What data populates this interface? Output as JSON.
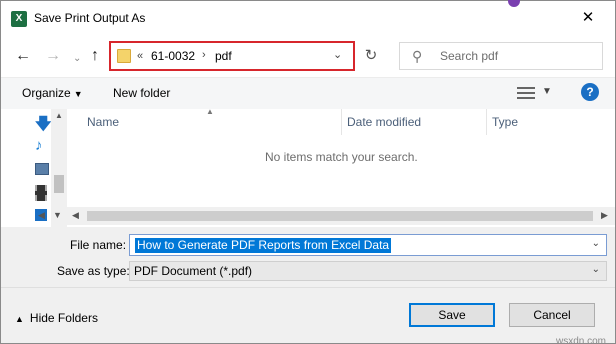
{
  "window": {
    "title": "Save Print Output As",
    "app_icon": "X",
    "close_glyph": "✕"
  },
  "address": {
    "overflow": "«",
    "crumbs": [
      "61-0032",
      "pdf"
    ],
    "separator": "›",
    "accent": "#d7262c"
  },
  "search": {
    "placeholder": "Search pdf"
  },
  "toolbar": {
    "organize": "Organize",
    "new_folder": "New folder",
    "help": "?"
  },
  "columns": [
    "Name",
    "Date modified",
    "Type"
  ],
  "empty_message": "No items match your search.",
  "fields": {
    "file_name_label": "File name:",
    "file_name_value": "How to Generate PDF Reports from Excel Data",
    "save_as_type_label": "Save as type:",
    "save_as_type_value": "PDF Document (*.pdf)"
  },
  "footer": {
    "hide_folders": "Hide Folders",
    "save": "Save",
    "cancel": "Cancel",
    "watermark": "wsxdn.com"
  },
  "icons": [
    "excel-app-icon",
    "close-icon",
    "back-arrow-icon",
    "forward-arrow-icon",
    "dropdown-icon",
    "up-arrow-icon",
    "folder-icon",
    "refresh-icon",
    "search-icon",
    "view-options-icon",
    "help-icon",
    "download-arrow-icon",
    "music-icon",
    "pictures-icon",
    "videos-icon",
    "windows-drive-icon"
  ]
}
